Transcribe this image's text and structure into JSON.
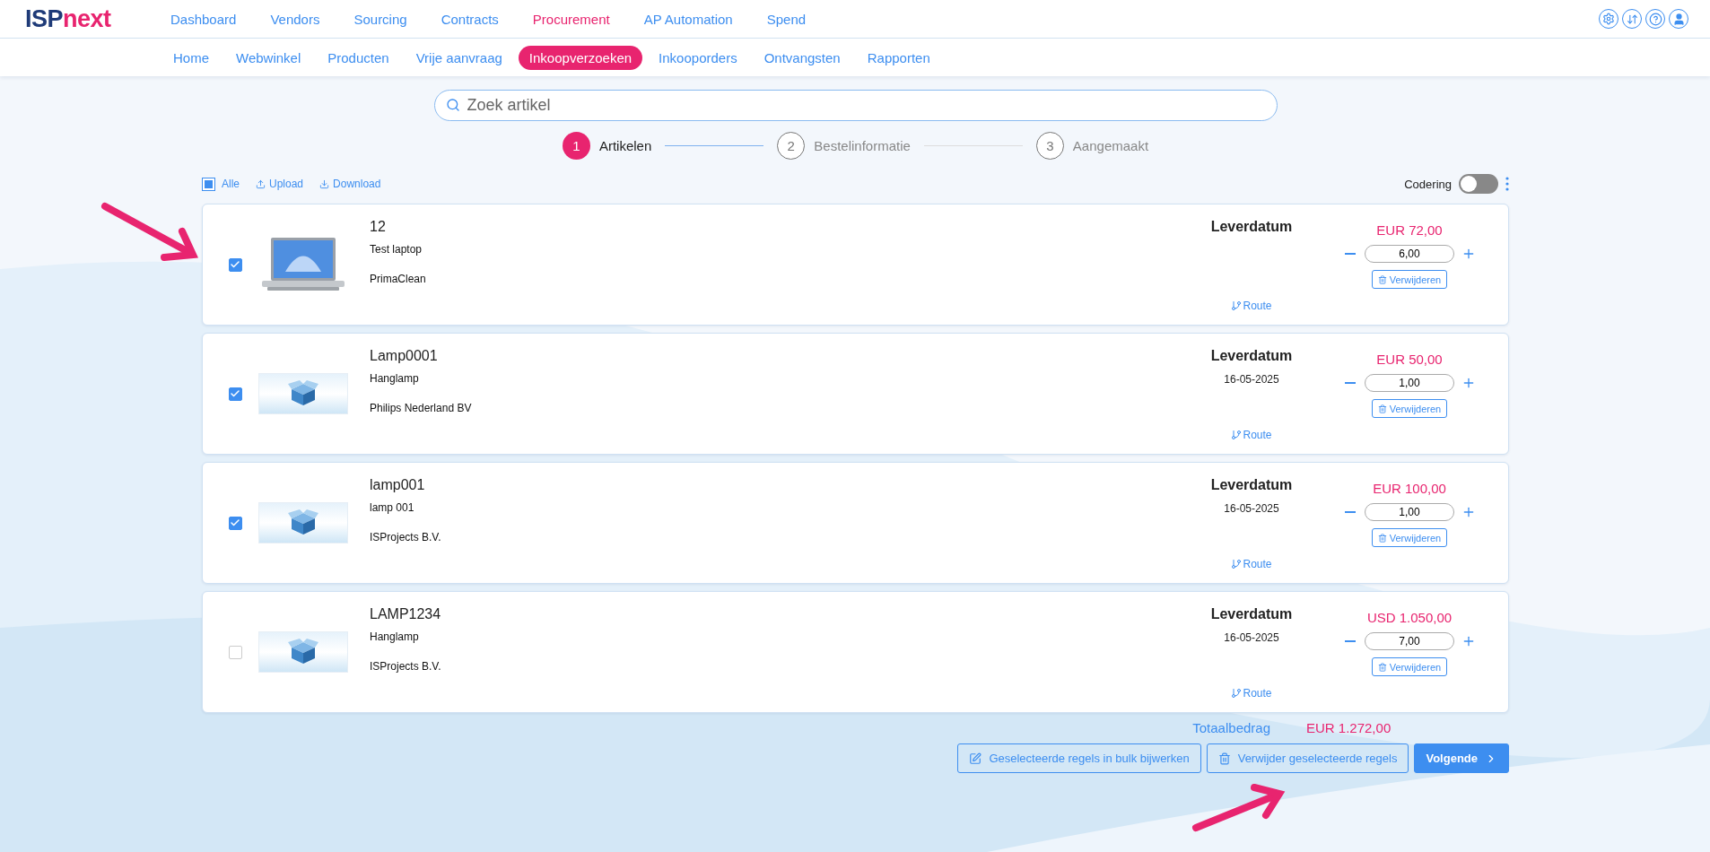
{
  "logo": {
    "part1": "ISP",
    "part2": "next"
  },
  "main_nav": [
    {
      "label": "Dashboard",
      "selected": false
    },
    {
      "label": "Vendors",
      "selected": false
    },
    {
      "label": "Sourcing",
      "selected": false
    },
    {
      "label": "Contracts",
      "selected": false
    },
    {
      "label": "Procurement",
      "selected": true
    },
    {
      "label": "AP Automation",
      "selected": false
    },
    {
      "label": "Spend",
      "selected": false
    }
  ],
  "sub_nav": [
    {
      "label": "Home",
      "selected": false
    },
    {
      "label": "Webwinkel",
      "selected": false
    },
    {
      "label": "Producten",
      "selected": false
    },
    {
      "label": "Vrije aanvraag",
      "selected": false
    },
    {
      "label": "Inkoopverzoeken",
      "selected": true
    },
    {
      "label": "Inkooporders",
      "selected": false
    },
    {
      "label": "Ontvangsten",
      "selected": false
    },
    {
      "label": "Rapporten",
      "selected": false
    }
  ],
  "search": {
    "placeholder": "Zoek artikel"
  },
  "steps": [
    {
      "number": "1",
      "label": "Artikelen",
      "selected": true
    },
    {
      "number": "2",
      "label": "Bestelinformatie",
      "selected": false
    },
    {
      "number": "3",
      "label": "Aangemaakt",
      "selected": false
    }
  ],
  "toolbar": {
    "select_all": {
      "label": "Alle",
      "partial": true
    },
    "upload": "Upload",
    "download": "Download",
    "toggle": {
      "label": "Codering",
      "on": false
    }
  },
  "items": [
    {
      "code": "12",
      "name": "Test laptop",
      "supplier": "PrimaClean",
      "kind": "laptop",
      "checked": true,
      "date_label": "Leverdatum",
      "route": "Route",
      "price": "EUR 72,00",
      "quantity": "6,00",
      "remove": "Verwijderen"
    },
    {
      "code": "Lamp0001",
      "name": "Hanglamp",
      "supplier": "Philips Nederland BV",
      "kind": "box",
      "checked": true,
      "date_label": "Leverdatum",
      "date": "16-05-2025",
      "route": "Route",
      "price": "EUR 50,00",
      "quantity": "1,00",
      "remove": "Verwijderen"
    },
    {
      "code": "lamp001",
      "name": "lamp 001",
      "supplier": "ISProjects B.V.",
      "kind": "box",
      "checked": true,
      "date_label": "Leverdatum",
      "date": "16-05-2025",
      "route": "Route",
      "price": "EUR 100,00",
      "quantity": "1,00",
      "remove": "Verwijderen"
    },
    {
      "code": "LAMP1234",
      "name": "Hanglamp",
      "supplier": "ISProjects B.V.",
      "kind": "box",
      "checked": false,
      "date_label": "Leverdatum",
      "date": "16-05-2025",
      "route": "Route",
      "price": "USD 1.050,00",
      "quantity": "7,00",
      "remove": "Verwijderen"
    }
  ],
  "total": {
    "label": "Totaalbedrag",
    "value": "EUR 1.272,00"
  },
  "actions": [
    {
      "kind": "edit",
      "label": "Geselecteerde regels in bulk bijwerken"
    },
    {
      "kind": "delete",
      "label": "Verwijder geselecteerde regels"
    },
    {
      "kind": "next",
      "label": "Volgende"
    }
  ]
}
